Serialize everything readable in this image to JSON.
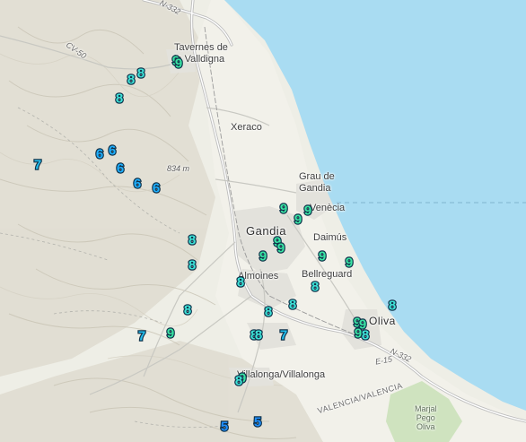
{
  "labels": {
    "tavernes": "Tavernes de\nla Valldigna",
    "cv50": "CV-50",
    "n332_top": "N-332",
    "xeraco": "Xeraco",
    "elev": "834 m",
    "grau": "Grau de\nGandia",
    "gandia": "Gandia",
    "venecia": "Venècia",
    "daimus": "Daimús",
    "bellreguard": "Bellreguard",
    "almoines": "Almoines",
    "oliva": "Oliva",
    "n332_bottom": "N-332",
    "e15": "E-15",
    "villalonga": "Villalonga/Villalonga",
    "valencia": "VALENCIA/VALENCIA",
    "marjal": "Marjal\nPego\nOliva"
  },
  "markers": [
    {
      "value": "9",
      "level": "9"
    },
    {
      "value": "9",
      "level": "9"
    },
    {
      "value": "8",
      "level": "8"
    },
    {
      "value": "8",
      "level": "8"
    },
    {
      "value": "8",
      "level": "8"
    },
    {
      "value": "7",
      "level": "7"
    },
    {
      "value": "6",
      "level": "6"
    },
    {
      "value": "6",
      "level": "6"
    },
    {
      "value": "6",
      "level": "6"
    },
    {
      "value": "6",
      "level": "6"
    },
    {
      "value": "6",
      "level": "6"
    },
    {
      "value": "9",
      "level": "9"
    },
    {
      "value": "9",
      "level": "9"
    },
    {
      "value": "9",
      "level": "9"
    },
    {
      "value": "9",
      "level": "9"
    },
    {
      "value": "9",
      "level": "9"
    },
    {
      "value": "9",
      "level": "9"
    },
    {
      "value": "9",
      "level": "9"
    },
    {
      "value": "9",
      "level": "9"
    },
    {
      "value": "8",
      "level": "8"
    },
    {
      "value": "8",
      "level": "8"
    },
    {
      "value": "8",
      "level": "8"
    },
    {
      "value": "8",
      "level": "8"
    },
    {
      "value": "8",
      "level": "8"
    },
    {
      "value": "8",
      "level": "8"
    },
    {
      "value": "8",
      "level": "8"
    },
    {
      "value": "8",
      "level": "8"
    },
    {
      "value": "8",
      "level": "8"
    },
    {
      "value": "8",
      "level": "8"
    },
    {
      "value": "7",
      "level": "7"
    },
    {
      "value": "7",
      "level": "7"
    },
    {
      "value": "9",
      "level": "9"
    },
    {
      "value": "9",
      "level": "9"
    },
    {
      "value": "9",
      "level": "9"
    },
    {
      "value": "9",
      "level": "9"
    },
    {
      "value": "8",
      "level": "8"
    },
    {
      "value": "9",
      "level": "9"
    },
    {
      "value": "8",
      "level": "8"
    },
    {
      "value": "5",
      "level": "5"
    },
    {
      "value": "5",
      "level": "5"
    }
  ]
}
